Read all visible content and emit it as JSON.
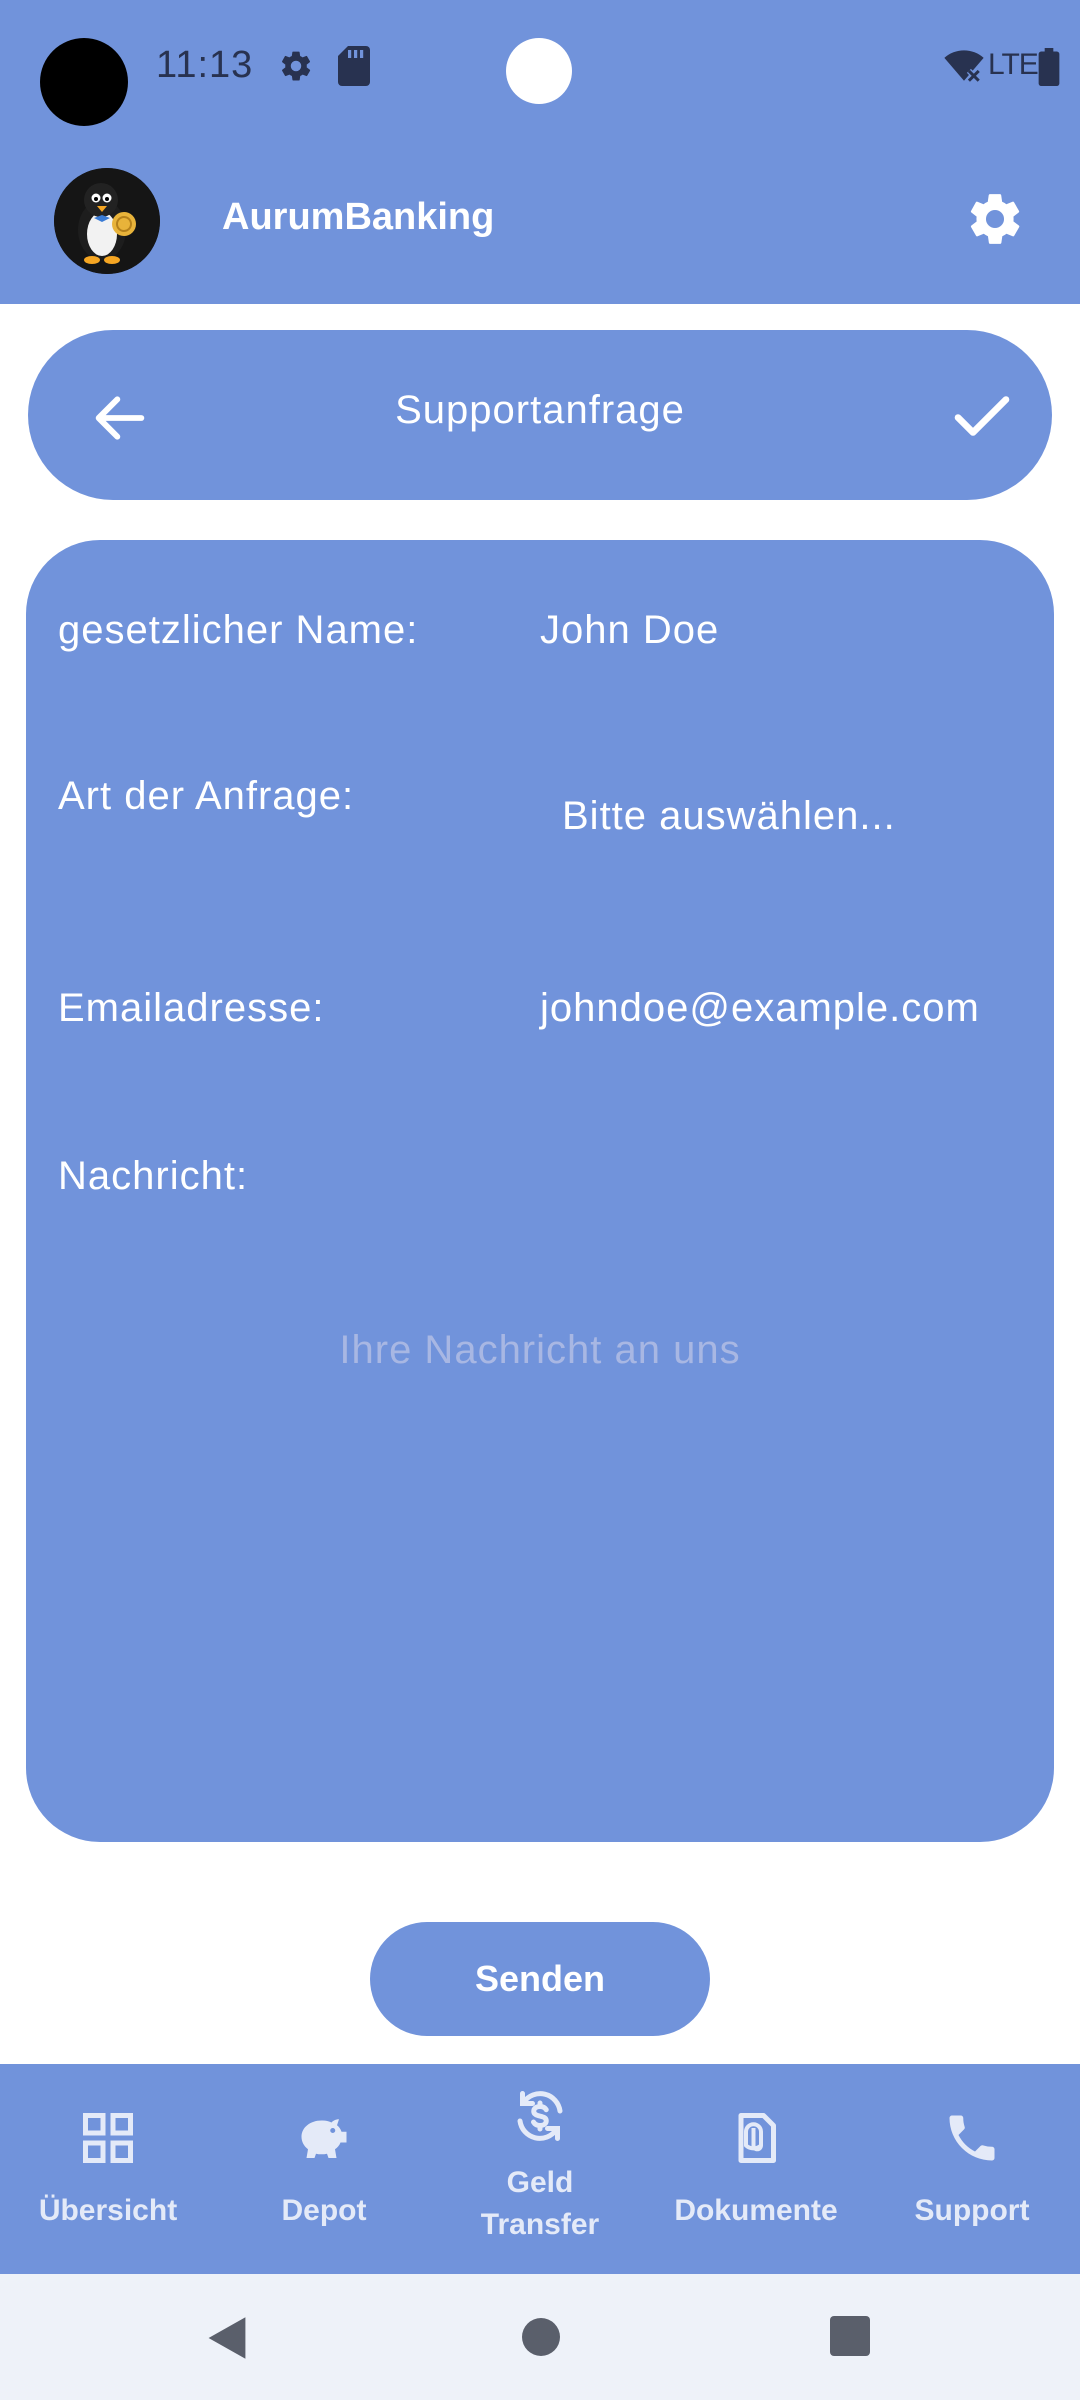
{
  "status_bar": {
    "time": "11:13",
    "network": "LTE",
    "icons": [
      "gear-icon",
      "sd-card-icon",
      "wifi-off-icon",
      "battery-icon"
    ]
  },
  "app_bar": {
    "title": "AurumBanking",
    "avatar_icon": "penguin-logo",
    "settings_icon": "gear-icon"
  },
  "header": {
    "title": "Supportanfrage",
    "back_icon": "arrow-left-icon",
    "confirm_icon": "check-icon"
  },
  "form": {
    "name_label": "gesetzlicher Name:",
    "name_value": "John Doe",
    "type_label": "Art der Anfrage:",
    "type_value": "Bitte auswählen...",
    "email_label": "Emailadresse:",
    "email_value": "johndoe@example.com",
    "message_label": "Nachricht:",
    "message_placeholder": "Ihre Nachricht an uns"
  },
  "send_button": {
    "label": "Senden"
  },
  "bottom_nav": {
    "items": [
      {
        "label": "Übersicht",
        "icon": "grid-icon"
      },
      {
        "label": "Depot",
        "icon": "piggy-bank-icon"
      },
      {
        "label": "Geld\nTransfer",
        "icon": "currency-exchange-icon"
      },
      {
        "label": "Dokumente",
        "icon": "document-attachment-icon"
      },
      {
        "label": "Support",
        "icon": "phone-icon"
      }
    ]
  },
  "colors": {
    "primary": "#7193db",
    "white": "#ffffff",
    "placeholder": "#a8b7e3",
    "nav_text": "#e4eaf8",
    "system_nav_bg": "#eef2f9"
  }
}
